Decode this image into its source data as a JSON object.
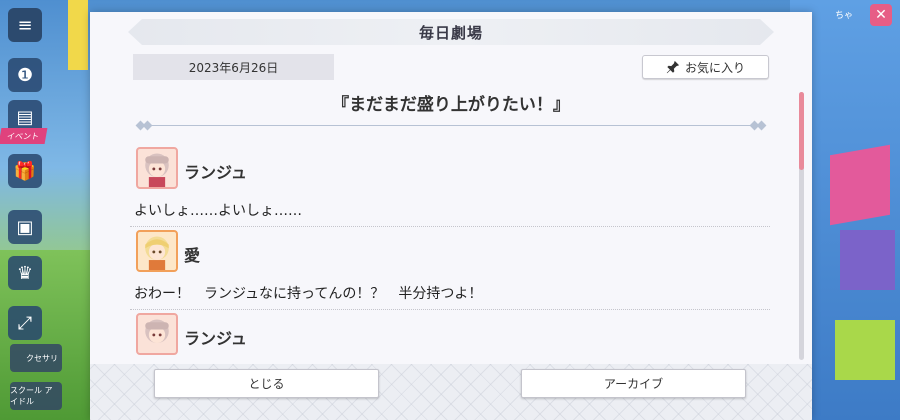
{
  "dialog": {
    "title": "毎日劇場",
    "date": "2023年6月26日",
    "favorite_label": "お気に入り",
    "story_title": "『まだまだ盛り上がりたい！』",
    "entries": [
      {
        "speaker": "ランジュ",
        "text": "よいしょ……よいしょ……",
        "avatar": "ranju-avatar"
      },
      {
        "speaker": "愛",
        "text": "おわー！　ランジュなに持ってんの！？　半分持つよ！",
        "avatar": "ai-avatar"
      },
      {
        "speaker": "ランジュ",
        "text": "",
        "avatar": "ranju-avatar"
      }
    ],
    "close_label": "とじる",
    "archive_label": "アーカイブ",
    "scroll_position": 0.0
  },
  "icons": {
    "menu": "hamburger-icon",
    "pin": "pin-icon",
    "close": "close-icon"
  },
  "side": {
    "tag": "イベント",
    "buttons": [
      "クセサリ",
      "スクール アイドル"
    ]
  },
  "top_right": {
    "text": "ちゃ"
  },
  "colors": {
    "accent_pink": "#e98a9a",
    "dialog_bg": "#f7f7fb"
  }
}
